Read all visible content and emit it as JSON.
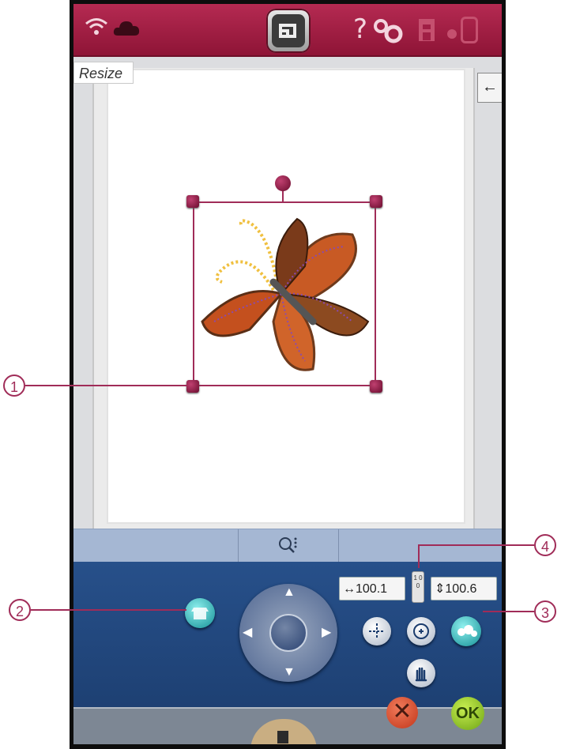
{
  "topbar": {
    "help_glyph": "?",
    "icons": [
      "wifi-icon",
      "cloud-icon",
      "home-icon",
      "help-icon",
      "settings-icon",
      "machine-seat-icon",
      "indicator-dot-icon",
      "tablet-icon"
    ]
  },
  "canvas": {
    "mode_label": "Resize",
    "side_button_glyph": "←"
  },
  "zoom": {
    "icon": "zoom-options-icon"
  },
  "size": {
    "width_value": "100.1",
    "height_value": "100.6",
    "width_prefix": "↔",
    "height_prefix": "⇕",
    "lock_text": "1 0 0"
  },
  "actions": {
    "cancel_glyph": "✕",
    "ok_label": "OK"
  },
  "callouts": {
    "c1": "1",
    "c2": "2",
    "c3": "3",
    "c4": "4"
  },
  "colors": {
    "topbar": "#a01f45",
    "accent": "#a02c58",
    "controls_bg": "#27508a",
    "ok": "#8bc21f",
    "cancel": "#d94a2a"
  }
}
